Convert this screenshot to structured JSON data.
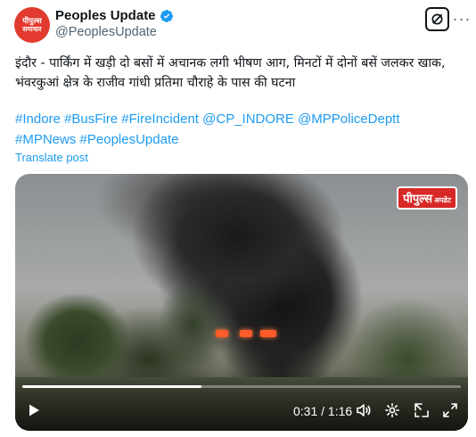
{
  "author": {
    "avatar_line1": "पीपुल्स",
    "avatar_line2": "समाचार",
    "display_name": "Peoples Update",
    "handle": "@PeoplesUpdate",
    "verified_color": "#1d9bf0"
  },
  "header_actions": {
    "grok_icon": "grok-icon",
    "more_label": "···"
  },
  "tweet": {
    "text": "इंदौर - पार्किंग में खड़ी दो बसों में अचानक लगी भीषण आग, मिनटों में दोनों बसें जलकर खाक, भंवरकुआं क्षेत्र के राजीव गांधी प्रतिमा चौराहे के पास की घटना",
    "hashtags_line1": [
      "#Indore",
      "#BusFire",
      "#FireIncident",
      "@CP_INDORE",
      "@MPPoliceDeptt"
    ],
    "hashtags_line2": [
      "#MPNews",
      "#PeoplesUpdate"
    ],
    "translate_label": "Translate post",
    "link_color": "#1d9bf0"
  },
  "video": {
    "logo_big": "पीपुल्स",
    "logo_small": "अपडेट",
    "time_label": "0:31 / 1:16",
    "progress_fraction": 0.408,
    "icons": [
      "play-icon",
      "volume-icon",
      "settings-icon",
      "picture-in-picture-icon",
      "fullscreen-icon"
    ]
  }
}
